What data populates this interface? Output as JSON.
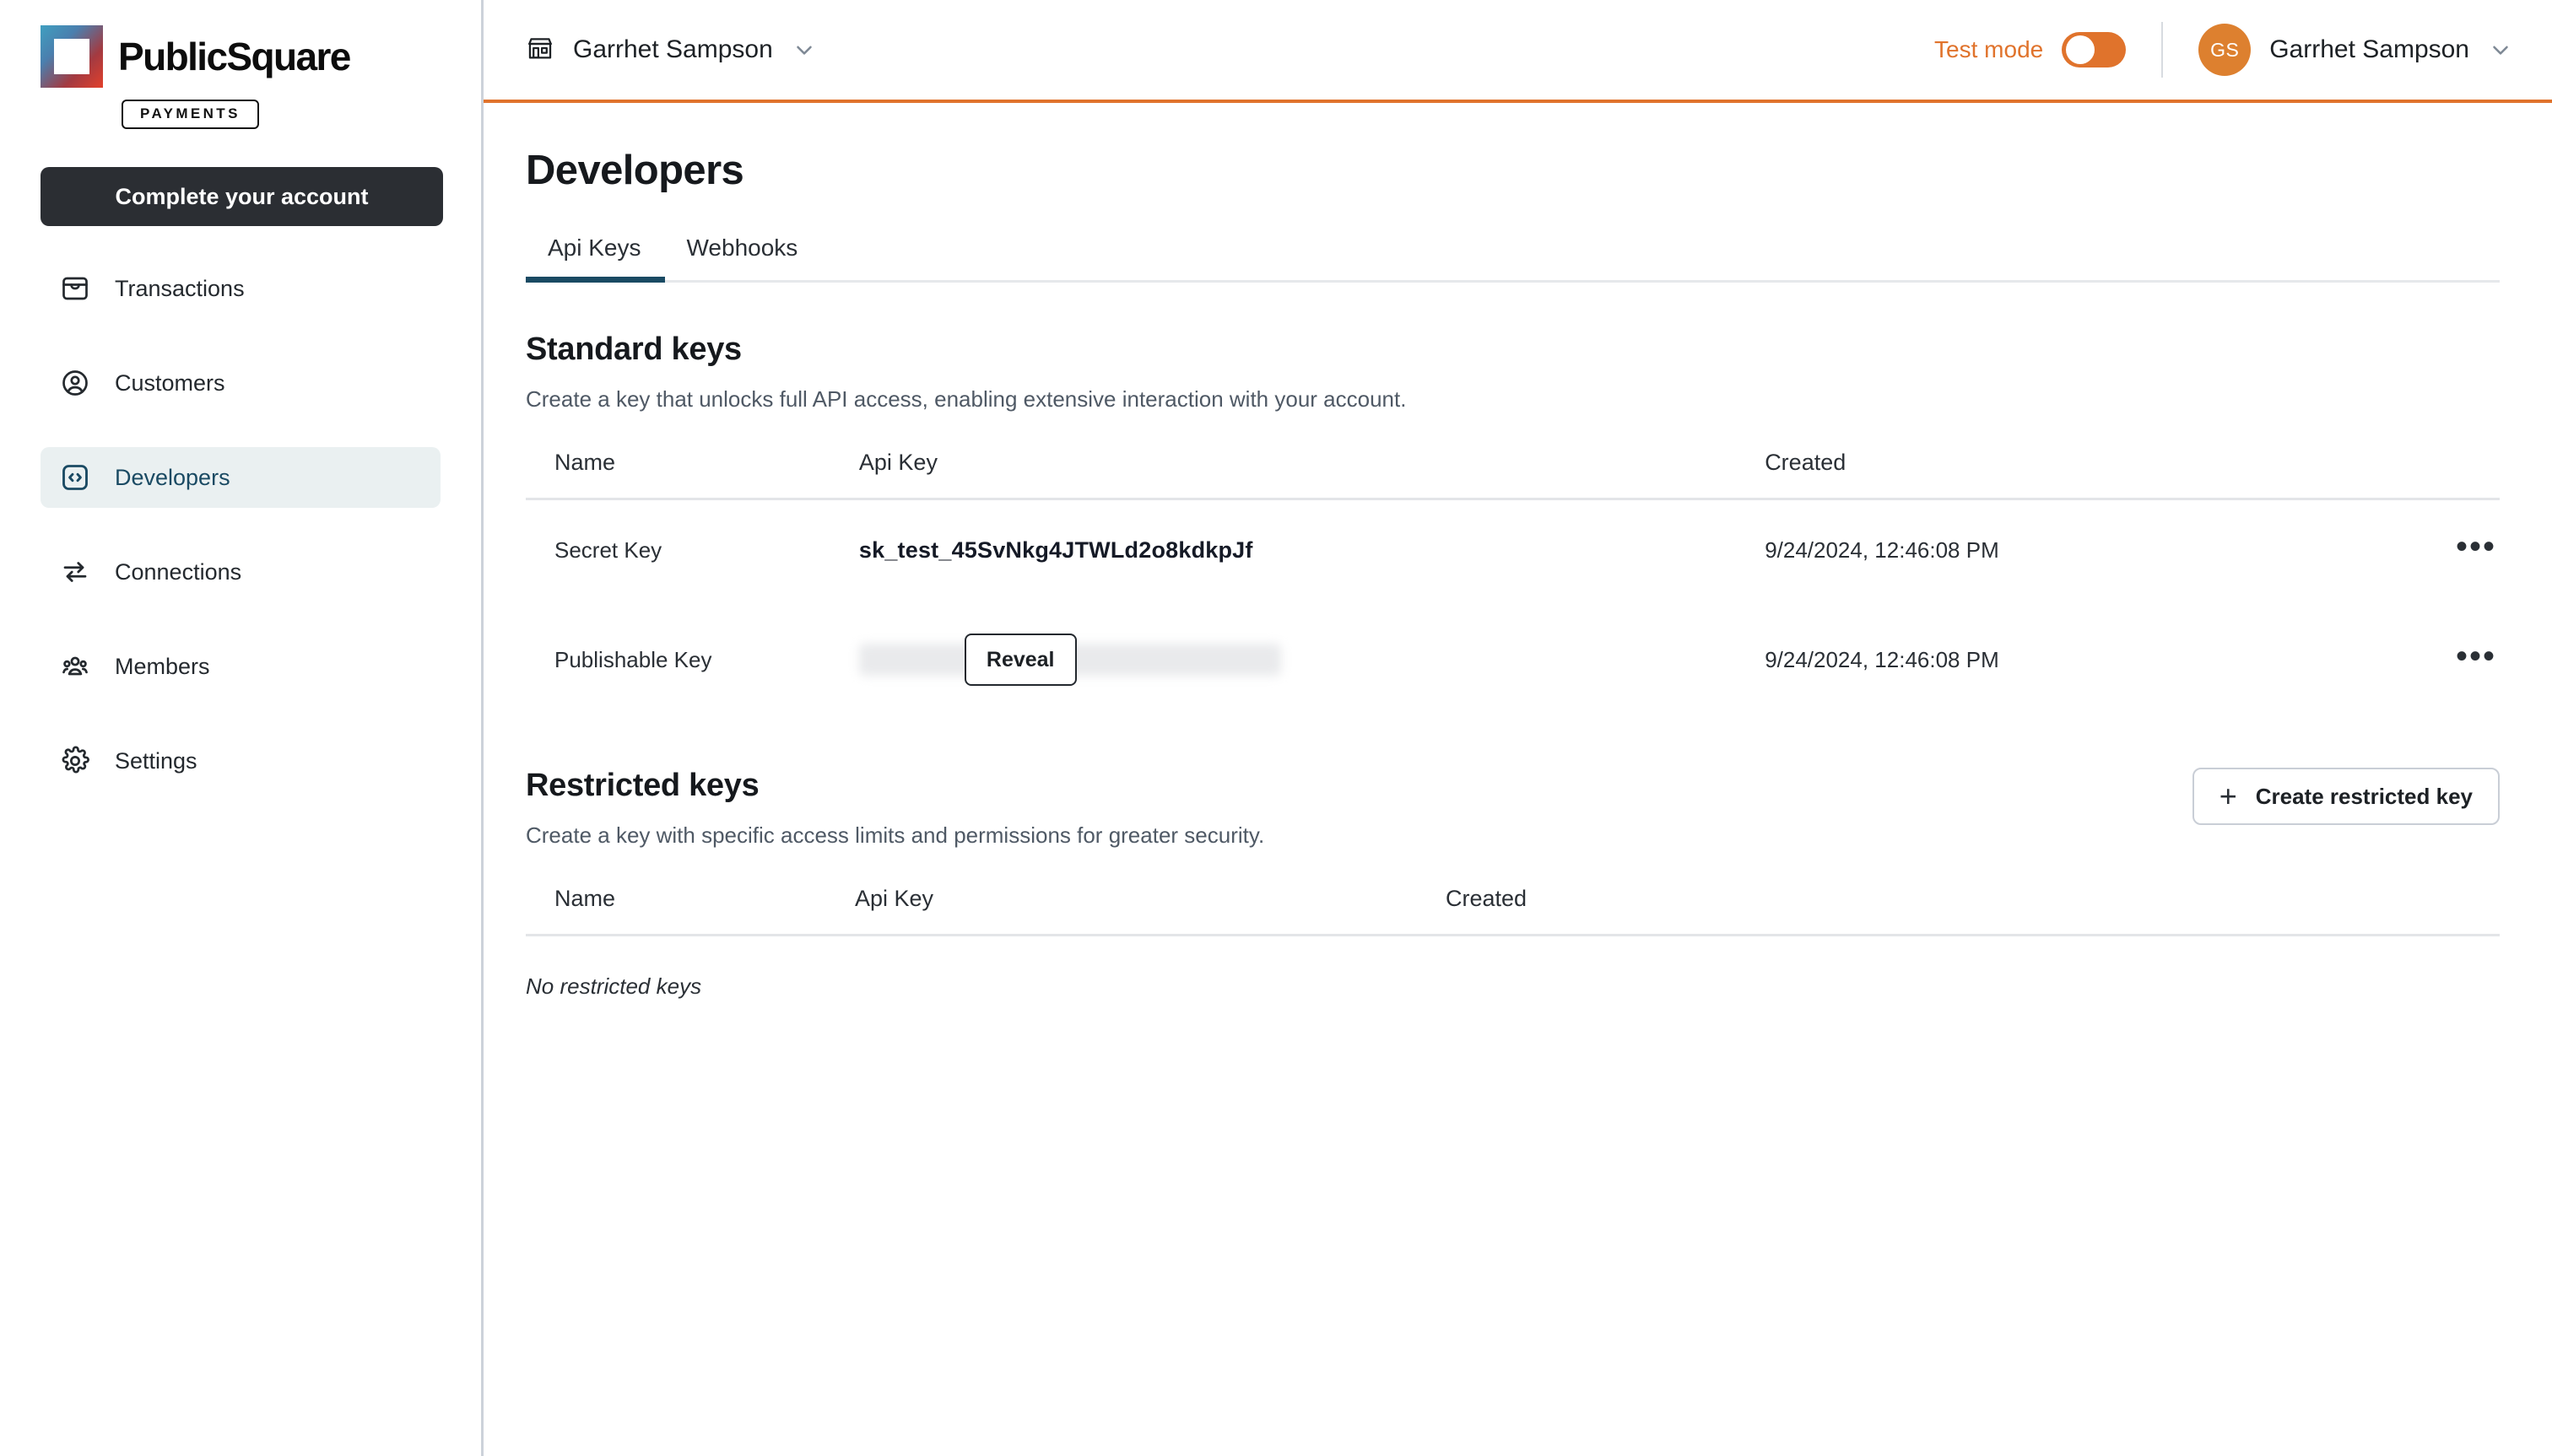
{
  "brand": {
    "name": "PublicSquare",
    "badge": "PAYMENTS",
    "logo_gradient_from": "#e2402b",
    "logo_gradient_to": "#3f9fc0"
  },
  "sidebar": {
    "cta_label": "Complete your account",
    "items": [
      {
        "label": "Transactions",
        "icon": "inbox-icon",
        "active": false
      },
      {
        "label": "Customers",
        "icon": "user-circle-icon",
        "active": false
      },
      {
        "label": "Developers",
        "icon": "code-brackets-icon",
        "active": true
      },
      {
        "label": "Connections",
        "icon": "transfer-arrows-icon",
        "active": false
      },
      {
        "label": "Members",
        "icon": "users-group-icon",
        "active": false
      },
      {
        "label": "Settings",
        "icon": "gear-icon",
        "active": false
      }
    ]
  },
  "topbar": {
    "merchant": "Garrhet Sampson",
    "merchant_icon": "storefront-icon",
    "merchant_chevron": "chevron-down-icon",
    "test_mode_label": "Test mode",
    "test_mode_on": true,
    "test_mode_color": "#e0732c",
    "avatar_initials": "GS",
    "avatar_color": "#dd802f",
    "user_name": "Garrhet Sampson",
    "user_chevron": "chevron-down-icon",
    "accent_underline": "#e0732c"
  },
  "page": {
    "title": "Developers",
    "tabs": [
      {
        "label": "Api Keys",
        "active": true
      },
      {
        "label": "Webhooks",
        "active": false
      }
    ],
    "tab_accent": "#1a4a63"
  },
  "standard_keys": {
    "title": "Standard keys",
    "description": "Create a key that unlocks full API access, enabling extensive interaction with your account.",
    "columns": [
      "Name",
      "Api Key",
      "Created"
    ],
    "rows": [
      {
        "name": "Secret Key",
        "api_key": "sk_test_45SvNkg4JTWLd2o8kdkpJf",
        "masked": false,
        "created": "9/24/2024, 12:46:08 PM",
        "actions_icon": "ellipsis-icon"
      },
      {
        "name": "Publishable Key",
        "api_key": "",
        "masked": true,
        "reveal_label": "Reveal",
        "created": "9/24/2024, 12:46:08 PM",
        "actions_icon": "ellipsis-icon"
      }
    ]
  },
  "restricted_keys": {
    "title": "Restricted keys",
    "description": "Create a key with specific access limits and permissions for greater security.",
    "create_label": "Create restricted key",
    "create_icon": "plus-icon",
    "columns": [
      "Name",
      "Api Key",
      "Created"
    ],
    "empty_message": "No restricted keys"
  }
}
